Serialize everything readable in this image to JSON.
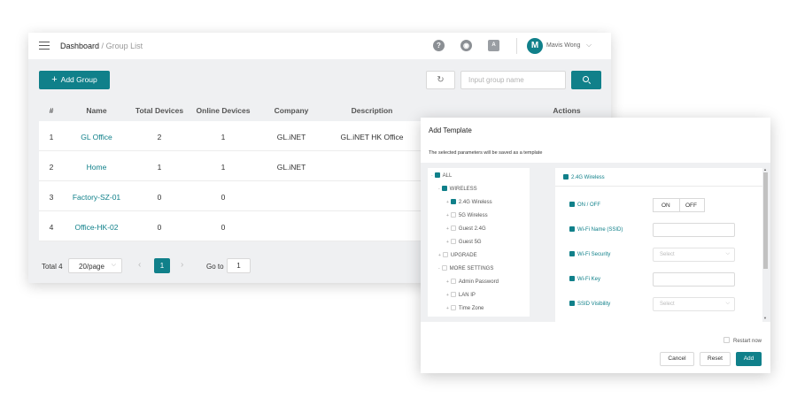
{
  "breadcrumb": {
    "main": "Dashboard",
    "sep": "/",
    "sub": "Group List"
  },
  "header": {
    "help_glyph": "?",
    "lang_glyph": "◉",
    "font_glyph": "A",
    "avatar_letter": "M",
    "user_name": "Mavis Wong",
    "chevron": "⌵"
  },
  "toolbar": {
    "add_label": "Add Group",
    "add_plus": "+",
    "refresh_glyph": "↻",
    "search_placeholder": "Input group name"
  },
  "table": {
    "columns": [
      "#",
      "Name",
      "Total Devices",
      "Online Devices",
      "Company",
      "Description",
      "Actions"
    ],
    "rows": [
      {
        "idx": "1",
        "name": "GL Office",
        "total": "2",
        "online": "1",
        "company": "GL.iNET",
        "description": "GL.iNET HK Office"
      },
      {
        "idx": "2",
        "name": "Home",
        "total": "1",
        "online": "1",
        "company": "GL.iNET",
        "description": ""
      },
      {
        "idx": "3",
        "name": "Factory-SZ-01",
        "total": "0",
        "online": "0",
        "company": "",
        "description": ""
      },
      {
        "idx": "4",
        "name": "Office-HK-02",
        "total": "0",
        "online": "0",
        "company": "",
        "description": ""
      }
    ]
  },
  "pager": {
    "total": "Total 4",
    "page_size": "20/page",
    "prev": "‹",
    "current": "1",
    "next": "›",
    "goto_label": "Go to",
    "goto_value": "1"
  },
  "dialog": {
    "title": "Add Template",
    "subtitle": "The selected parameters will be saved as a template",
    "tree": [
      {
        "label": "ALL",
        "checked": true,
        "caret": "-"
      },
      {
        "label": "WIRELESS",
        "checked": true,
        "caret": "-"
      },
      {
        "label": "2.4G Wireless",
        "checked": true,
        "caret": "+"
      },
      {
        "label": "5G Wireless",
        "checked": false,
        "caret": "+"
      },
      {
        "label": "Guest 2.4G",
        "checked": false,
        "caret": "+"
      },
      {
        "label": "Guest 5G",
        "checked": false,
        "caret": "+"
      },
      {
        "label": "UPGRADE",
        "checked": false,
        "caret": "+"
      },
      {
        "label": "MORE SETTINGS",
        "checked": false,
        "caret": "-"
      },
      {
        "label": "Admin Password",
        "checked": false,
        "caret": "+"
      },
      {
        "label": "LAN IP",
        "checked": false,
        "caret": "+"
      },
      {
        "label": "Time Zone",
        "checked": false,
        "caret": "+"
      }
    ],
    "panel": {
      "header": "2.4G Wireless",
      "fields": {
        "onoff": "ON / OFF",
        "on": "ON",
        "off": "OFF",
        "ssid": "Wi-Fi Name (SSID)",
        "security": "Wi-Fi Security",
        "security_placeholder": "Select",
        "key": "Wi-Fi Key",
        "visibility": "SSID Visibility",
        "visibility_placeholder": "Select"
      }
    },
    "restart_label": "Restart now",
    "cancel_label": "Cancel",
    "reset_label": "Reset",
    "add_label": "Add"
  },
  "colors": {
    "accent": "#10808a",
    "background": "#eff0f2"
  }
}
